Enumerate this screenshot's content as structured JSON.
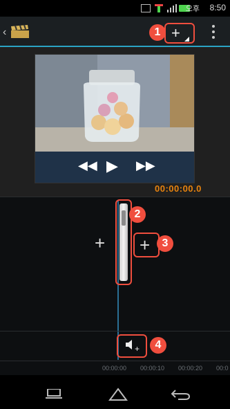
{
  "status_bar": {
    "time": "8:50",
    "ampm": "오후"
  },
  "app_bar": {
    "back_icon": "chevron-left-icon",
    "logo_icon": "clapperboard-icon",
    "add_media_icon": "add-media-icon",
    "menu_icon": "overflow-menu-icon"
  },
  "preview": {
    "controls": {
      "rewind": "◀◀",
      "play": "▶",
      "forward": "▶▶"
    },
    "timecode": "00:00:00.0"
  },
  "timeline": {
    "add_clip_left": "+",
    "add_clip_right": "+",
    "add_audio_icon": "🔈",
    "add_audio_plus": "+",
    "ruler_labels": [
      "00:00:00",
      "00:00:10",
      "00:00:20",
      "00:0"
    ]
  },
  "callouts": [
    "1",
    "2",
    "3",
    "4"
  ],
  "colors": {
    "accent": "#f04e3e",
    "timecode": "#e8830e",
    "appbar_line": "#2aa3c5",
    "playhead": "#2b6f95"
  }
}
